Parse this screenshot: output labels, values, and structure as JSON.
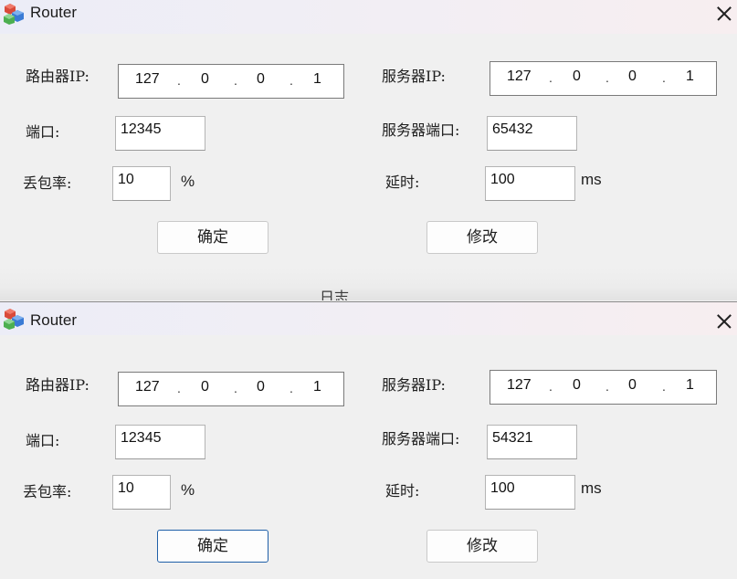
{
  "windows": [
    {
      "title": "Router",
      "router_ip_label": "路由器IP:",
      "router_ip": [
        "127",
        "0",
        "0",
        "1"
      ],
      "server_ip_label": "服务器IP:",
      "server_ip": [
        "127",
        "0",
        "0",
        "1"
      ],
      "port_label": "端口:",
      "port": "12345",
      "server_port_label": "服务器端口:",
      "server_port": "65432",
      "loss_label": "丢包率:",
      "loss": "10",
      "loss_unit": "%",
      "delay_label": "延时:",
      "delay": "100",
      "delay_unit": "ms",
      "confirm_label": "确定",
      "modify_label": "修改",
      "log_label": "日志"
    },
    {
      "title": "Router",
      "router_ip_label": "路由器IP:",
      "router_ip": [
        "127",
        "0",
        "0",
        "1"
      ],
      "server_ip_label": "服务器IP:",
      "server_ip": [
        "127",
        "0",
        "0",
        "1"
      ],
      "port_label": "端口:",
      "port": "12345",
      "server_port_label": "服务器端口:",
      "server_port": "54321",
      "loss_label": "丢包率:",
      "loss": "10",
      "loss_unit": "%",
      "delay_label": "延时:",
      "delay": "100",
      "delay_unit": "ms",
      "confirm_label": "确定",
      "modify_label": "修改"
    }
  ],
  "icons": {
    "app": "router-cubes-icon",
    "close": "close-icon"
  },
  "colors": {
    "focus_border": "#1f5fa8",
    "titlebar_left": "#ecedf7",
    "titlebar_right": "#f7eef0"
  }
}
